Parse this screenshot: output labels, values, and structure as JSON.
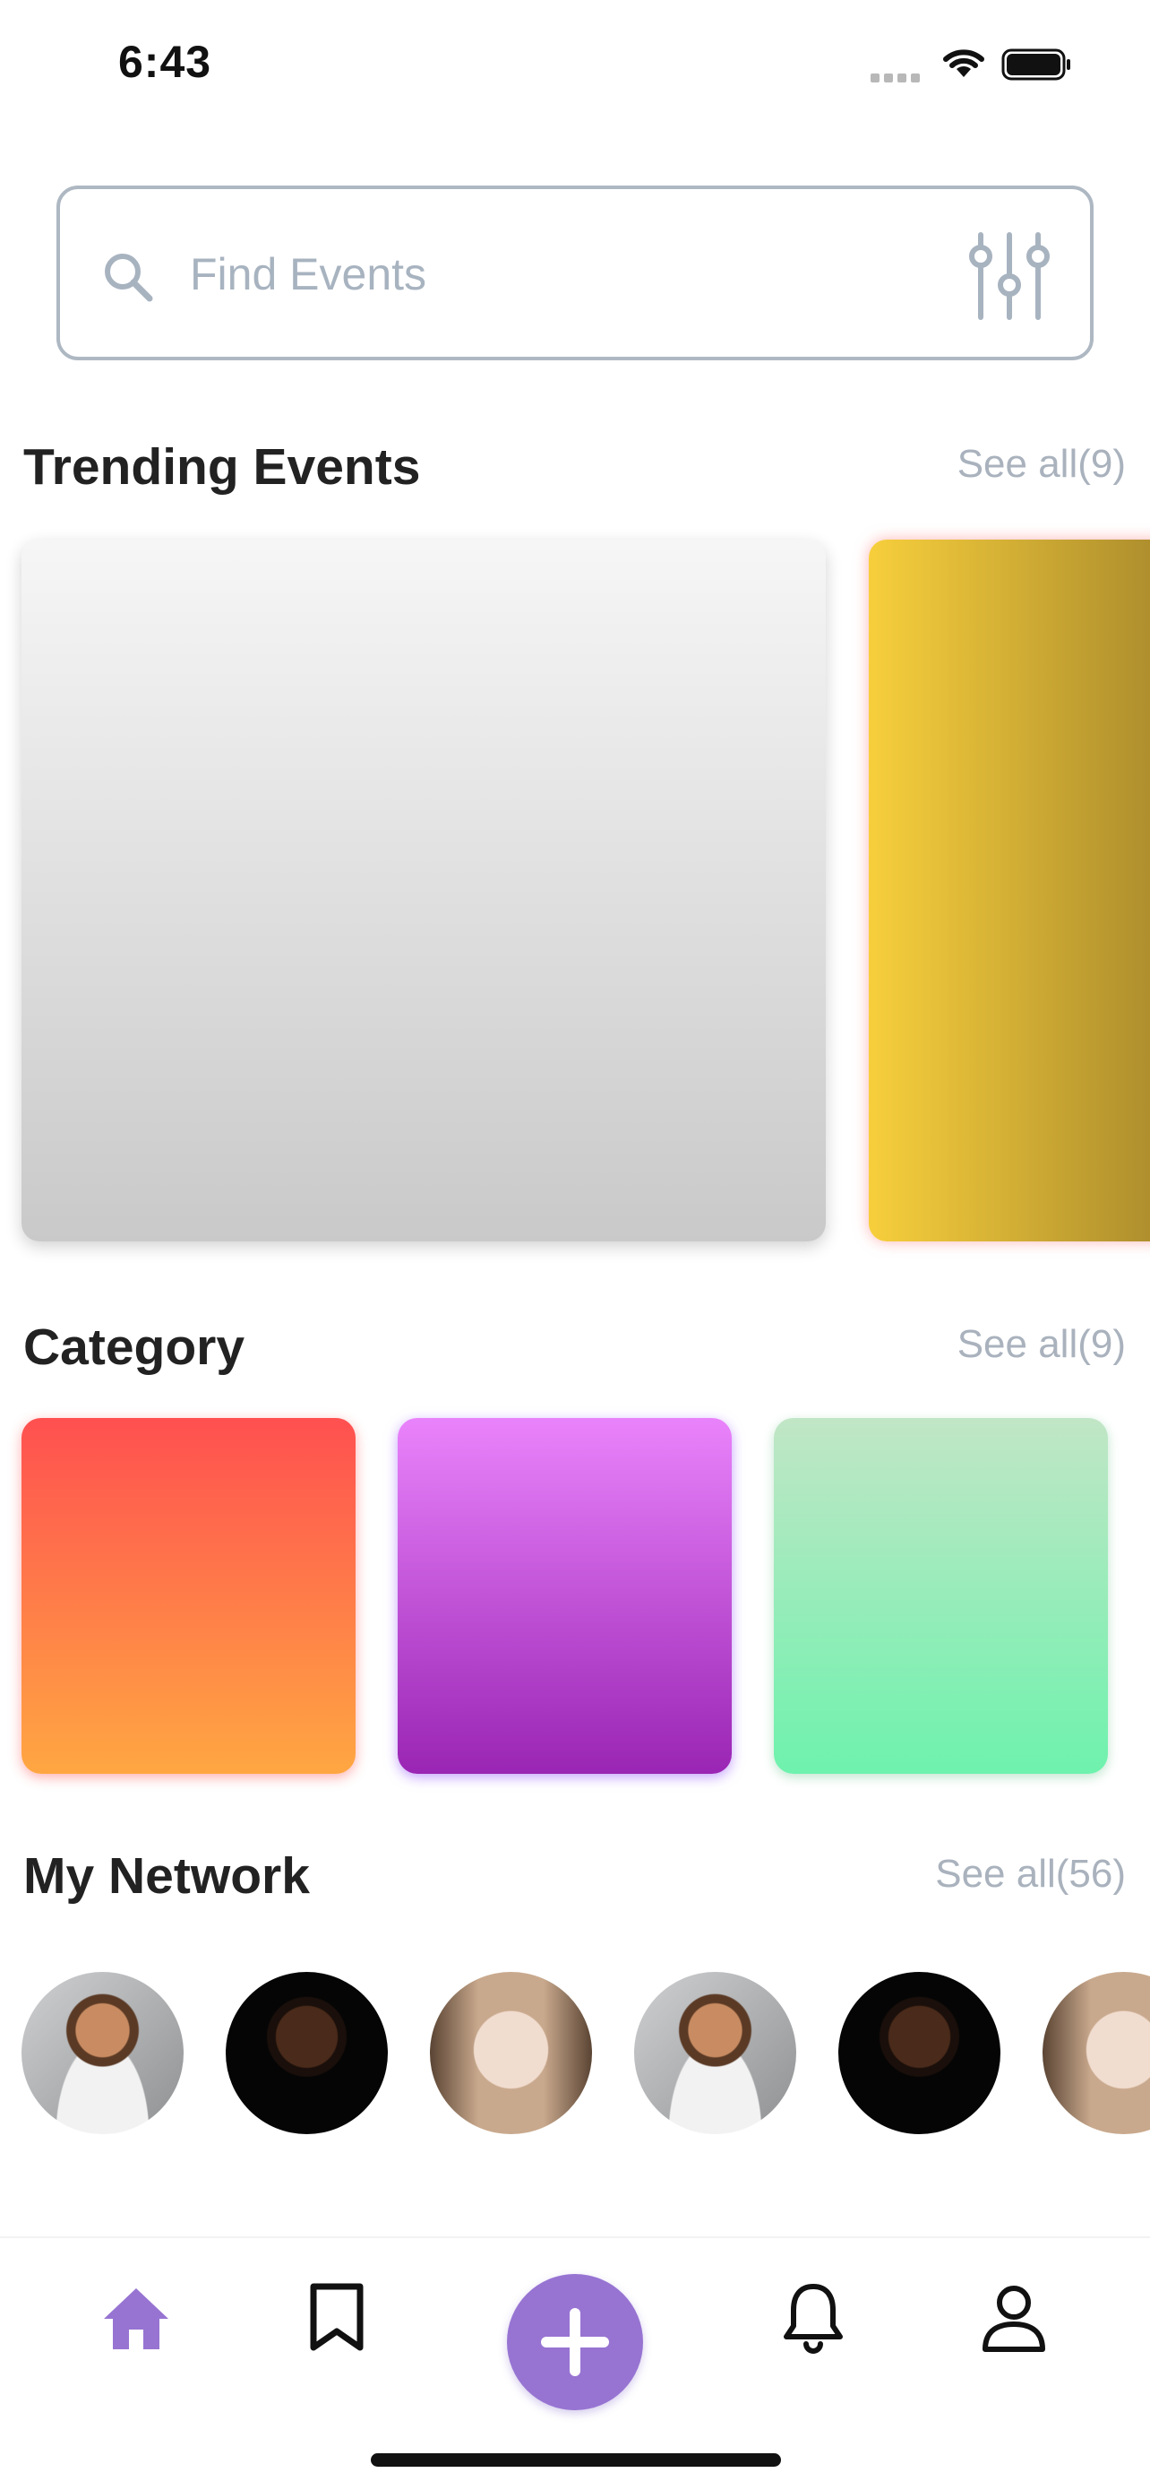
{
  "status_bar": {
    "time": "6:43",
    "icons": [
      "cellular-signal-icon",
      "wifi-icon",
      "battery-icon"
    ]
  },
  "search": {
    "placeholder": "Find Events",
    "value": "",
    "icons": [
      "search-icon",
      "filter-sliders-icon"
    ]
  },
  "sections": {
    "trending": {
      "title": "Trending Events",
      "see_all": "See all(9)"
    },
    "category": {
      "title": "Category",
      "see_all": "See all(9)"
    },
    "network": {
      "title": "My Network",
      "see_all": "See all(56)"
    }
  },
  "trending_cards": [
    {
      "colors": [
        "#f6f6f6",
        "#c9c9c9"
      ]
    },
    {
      "colors": [
        "#f7cf3c",
        "#a98a2c"
      ]
    }
  ],
  "category_cards": [
    {
      "colors": [
        "#ff5050",
        "#ffa742"
      ]
    },
    {
      "colors": [
        "#e983fb",
        "#9a25b4"
      ]
    },
    {
      "colors": [
        "#c1e6c6",
        "#6ef2ad"
      ]
    }
  ],
  "network_avatars": [
    "avatar",
    "avatar",
    "avatar",
    "avatar",
    "avatar",
    "avatar"
  ],
  "bottom_nav": {
    "items": [
      "home-icon",
      "bookmark-icon",
      "add-icon",
      "bell-icon",
      "profile-icon"
    ],
    "active": "home-icon",
    "accent": "#9774d2"
  }
}
